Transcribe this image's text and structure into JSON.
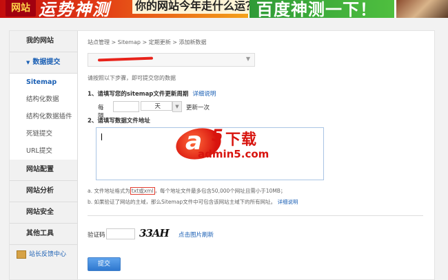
{
  "banner": {
    "logo_text": "网站",
    "calc_text": "运势神测",
    "question": "你的网站今年走什么运？",
    "cta": "百度神测一下！"
  },
  "sidebar": {
    "items": [
      {
        "label": "我的网站"
      },
      {
        "label": "数据提交"
      },
      {
        "label": "网站配置"
      },
      {
        "label": "网站分析"
      },
      {
        "label": "网站安全"
      },
      {
        "label": "其他工具"
      }
    ],
    "sub_items": [
      {
        "label": "Sitemap"
      },
      {
        "label": "结构化数据"
      },
      {
        "label": "结构化数据插件"
      },
      {
        "label": "死链提交"
      },
      {
        "label": "URL提交"
      }
    ],
    "feedback": "站长反馈中心"
  },
  "main": {
    "breadcrumb": "站点管理 > Sitemap > 定期更新 > 添加新数据",
    "hint": "请按照以下步骤，即可提交您的数据",
    "step1": {
      "title": "1、请填写您的sitemap文件更新周期",
      "link": "详细说明"
    },
    "frequency": {
      "prefix": "每隔",
      "value": "",
      "unit": "天",
      "suffix": "更新一次"
    },
    "step2": {
      "title": "2、请填写数据文件地址"
    },
    "note_a": {
      "prefix": "a. 文件地址格式为",
      "boxed": "txt或xml",
      "suffix": "，每个地址文件最多包含50,000个网址且需小于10MB；"
    },
    "note_b": {
      "text": "b. 如果验证了网站的主域，那么Sitemap文件中可包含该网站主域下的所有网址。",
      "link": "详细说明"
    },
    "captcha": {
      "label": "验证码",
      "value": "",
      "image_text": "33AH",
      "refresh": "点击图片刷新"
    },
    "submit": "提交"
  },
  "watermark": {
    "letter": "a",
    "digit": "5",
    "word": "下载",
    "site": "admin5.com"
  },
  "colors": {
    "link": "#1a5fb4",
    "accent": "#e8231b",
    "submit": "#2f78cf"
  }
}
